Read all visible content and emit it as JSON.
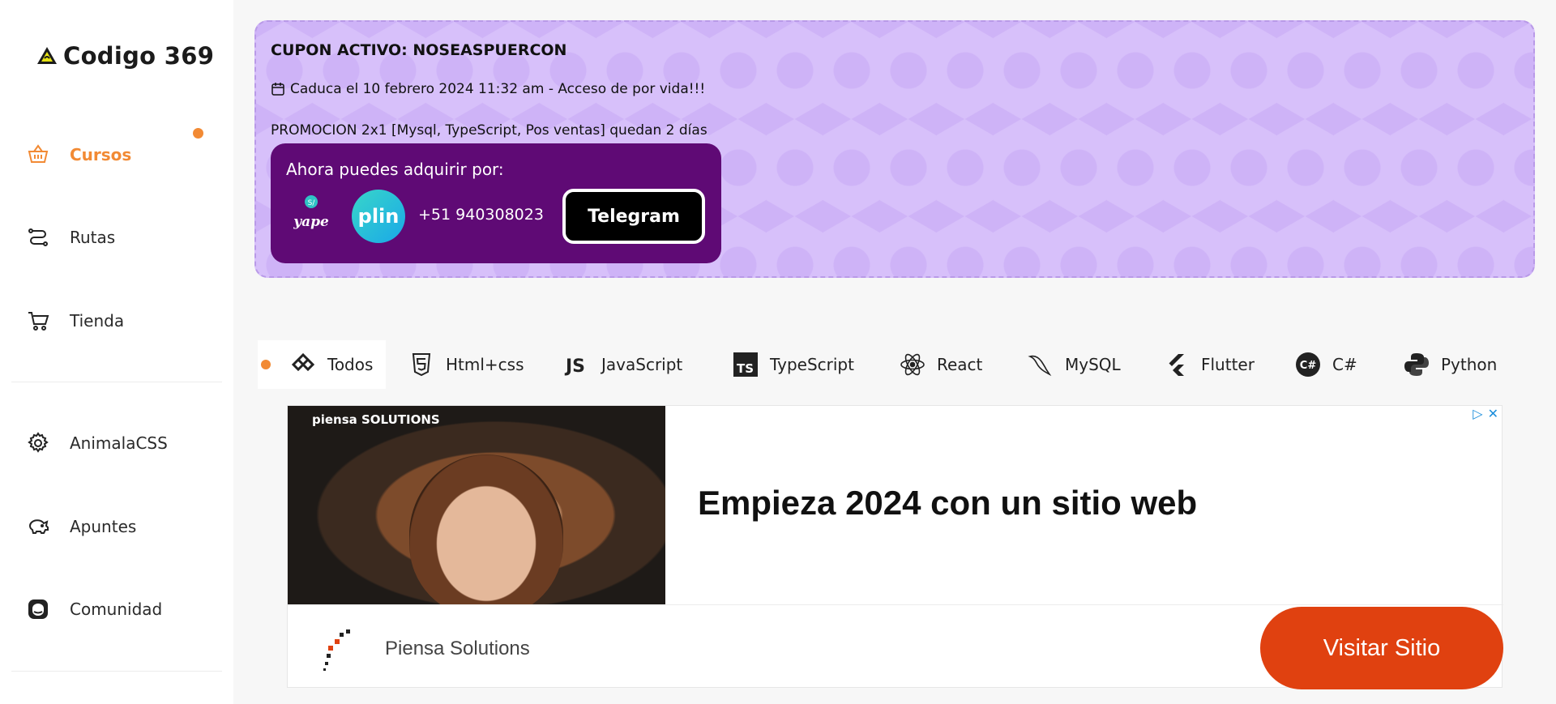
{
  "brand": {
    "name": "Codigo 369"
  },
  "sidebar": {
    "items": [
      {
        "label": "Cursos",
        "icon": "basket-icon"
      },
      {
        "label": "Rutas",
        "icon": "route-icon"
      },
      {
        "label": "Tienda",
        "icon": "cart-icon"
      },
      {
        "label": "AnimalaCSS",
        "icon": "gear-icon"
      },
      {
        "label": "Apuntes",
        "icon": "piggy-bank-icon"
      },
      {
        "label": "Comunidad",
        "icon": "community-icon"
      }
    ],
    "active_index": 0
  },
  "coupon": {
    "title": "CUPON ACTIVO: NOSEASPUERCON",
    "expiry": "Caduca el 10 febrero 2024 11:32 am - Acceso de por vida!!!",
    "promo": "PROMOCION 2x1 [Mysql, TypeScript, Pos ventas] quedan 2 días",
    "payment": {
      "title": "Ahora puedes adquirir por:",
      "yape_label": "yape",
      "plin_label": "plin",
      "phone": "+51 940308023",
      "telegram_label": "Telegram"
    }
  },
  "tabs": [
    {
      "label": "Todos",
      "icon": "all-icon"
    },
    {
      "label": "Html+css",
      "icon": "html5-icon"
    },
    {
      "label": "JavaScript",
      "icon": "javascript-icon"
    },
    {
      "label": "TypeScript",
      "icon": "typescript-icon"
    },
    {
      "label": "React",
      "icon": "react-icon"
    },
    {
      "label": "MySQL",
      "icon": "mysql-icon"
    },
    {
      "label": "Flutter",
      "icon": "flutter-icon"
    },
    {
      "label": "C#",
      "icon": "csharp-icon"
    },
    {
      "label": "Python",
      "icon": "python-icon"
    }
  ],
  "ad": {
    "brand": "piensa SOLUTIONS",
    "headline": "Empieza 2024 con un sitio web",
    "company": "Piensa Solutions",
    "cta": "Visitar Sitio"
  },
  "colors": {
    "accent": "#f28a34",
    "coupon_bg": "#d7c0fa",
    "pay_box": "#5f0a75",
    "cta": "#e04110"
  }
}
